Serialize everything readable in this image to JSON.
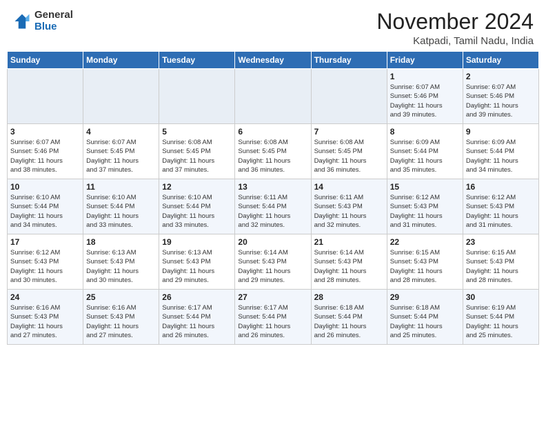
{
  "header": {
    "logo_general": "General",
    "logo_blue": "Blue",
    "month_title": "November 2024",
    "location": "Katpadi, Tamil Nadu, India"
  },
  "calendar": {
    "days_of_week": [
      "Sunday",
      "Monday",
      "Tuesday",
      "Wednesday",
      "Thursday",
      "Friday",
      "Saturday"
    ],
    "weeks": [
      [
        {
          "day": "",
          "info": ""
        },
        {
          "day": "",
          "info": ""
        },
        {
          "day": "",
          "info": ""
        },
        {
          "day": "",
          "info": ""
        },
        {
          "day": "",
          "info": ""
        },
        {
          "day": "1",
          "info": "Sunrise: 6:07 AM\nSunset: 5:46 PM\nDaylight: 11 hours\nand 39 minutes."
        },
        {
          "day": "2",
          "info": "Sunrise: 6:07 AM\nSunset: 5:46 PM\nDaylight: 11 hours\nand 39 minutes."
        }
      ],
      [
        {
          "day": "3",
          "info": "Sunrise: 6:07 AM\nSunset: 5:46 PM\nDaylight: 11 hours\nand 38 minutes."
        },
        {
          "day": "4",
          "info": "Sunrise: 6:07 AM\nSunset: 5:45 PM\nDaylight: 11 hours\nand 37 minutes."
        },
        {
          "day": "5",
          "info": "Sunrise: 6:08 AM\nSunset: 5:45 PM\nDaylight: 11 hours\nand 37 minutes."
        },
        {
          "day": "6",
          "info": "Sunrise: 6:08 AM\nSunset: 5:45 PM\nDaylight: 11 hours\nand 36 minutes."
        },
        {
          "day": "7",
          "info": "Sunrise: 6:08 AM\nSunset: 5:45 PM\nDaylight: 11 hours\nand 36 minutes."
        },
        {
          "day": "8",
          "info": "Sunrise: 6:09 AM\nSunset: 5:44 PM\nDaylight: 11 hours\nand 35 minutes."
        },
        {
          "day": "9",
          "info": "Sunrise: 6:09 AM\nSunset: 5:44 PM\nDaylight: 11 hours\nand 34 minutes."
        }
      ],
      [
        {
          "day": "10",
          "info": "Sunrise: 6:10 AM\nSunset: 5:44 PM\nDaylight: 11 hours\nand 34 minutes."
        },
        {
          "day": "11",
          "info": "Sunrise: 6:10 AM\nSunset: 5:44 PM\nDaylight: 11 hours\nand 33 minutes."
        },
        {
          "day": "12",
          "info": "Sunrise: 6:10 AM\nSunset: 5:44 PM\nDaylight: 11 hours\nand 33 minutes."
        },
        {
          "day": "13",
          "info": "Sunrise: 6:11 AM\nSunset: 5:44 PM\nDaylight: 11 hours\nand 32 minutes."
        },
        {
          "day": "14",
          "info": "Sunrise: 6:11 AM\nSunset: 5:43 PM\nDaylight: 11 hours\nand 32 minutes."
        },
        {
          "day": "15",
          "info": "Sunrise: 6:12 AM\nSunset: 5:43 PM\nDaylight: 11 hours\nand 31 minutes."
        },
        {
          "day": "16",
          "info": "Sunrise: 6:12 AM\nSunset: 5:43 PM\nDaylight: 11 hours\nand 31 minutes."
        }
      ],
      [
        {
          "day": "17",
          "info": "Sunrise: 6:12 AM\nSunset: 5:43 PM\nDaylight: 11 hours\nand 30 minutes."
        },
        {
          "day": "18",
          "info": "Sunrise: 6:13 AM\nSunset: 5:43 PM\nDaylight: 11 hours\nand 30 minutes."
        },
        {
          "day": "19",
          "info": "Sunrise: 6:13 AM\nSunset: 5:43 PM\nDaylight: 11 hours\nand 29 minutes."
        },
        {
          "day": "20",
          "info": "Sunrise: 6:14 AM\nSunset: 5:43 PM\nDaylight: 11 hours\nand 29 minutes."
        },
        {
          "day": "21",
          "info": "Sunrise: 6:14 AM\nSunset: 5:43 PM\nDaylight: 11 hours\nand 28 minutes."
        },
        {
          "day": "22",
          "info": "Sunrise: 6:15 AM\nSunset: 5:43 PM\nDaylight: 11 hours\nand 28 minutes."
        },
        {
          "day": "23",
          "info": "Sunrise: 6:15 AM\nSunset: 5:43 PM\nDaylight: 11 hours\nand 28 minutes."
        }
      ],
      [
        {
          "day": "24",
          "info": "Sunrise: 6:16 AM\nSunset: 5:43 PM\nDaylight: 11 hours\nand 27 minutes."
        },
        {
          "day": "25",
          "info": "Sunrise: 6:16 AM\nSunset: 5:43 PM\nDaylight: 11 hours\nand 27 minutes."
        },
        {
          "day": "26",
          "info": "Sunrise: 6:17 AM\nSunset: 5:44 PM\nDaylight: 11 hours\nand 26 minutes."
        },
        {
          "day": "27",
          "info": "Sunrise: 6:17 AM\nSunset: 5:44 PM\nDaylight: 11 hours\nand 26 minutes."
        },
        {
          "day": "28",
          "info": "Sunrise: 6:18 AM\nSunset: 5:44 PM\nDaylight: 11 hours\nand 26 minutes."
        },
        {
          "day": "29",
          "info": "Sunrise: 6:18 AM\nSunset: 5:44 PM\nDaylight: 11 hours\nand 25 minutes."
        },
        {
          "day": "30",
          "info": "Sunrise: 6:19 AM\nSunset: 5:44 PM\nDaylight: 11 hours\nand 25 minutes."
        }
      ]
    ]
  }
}
